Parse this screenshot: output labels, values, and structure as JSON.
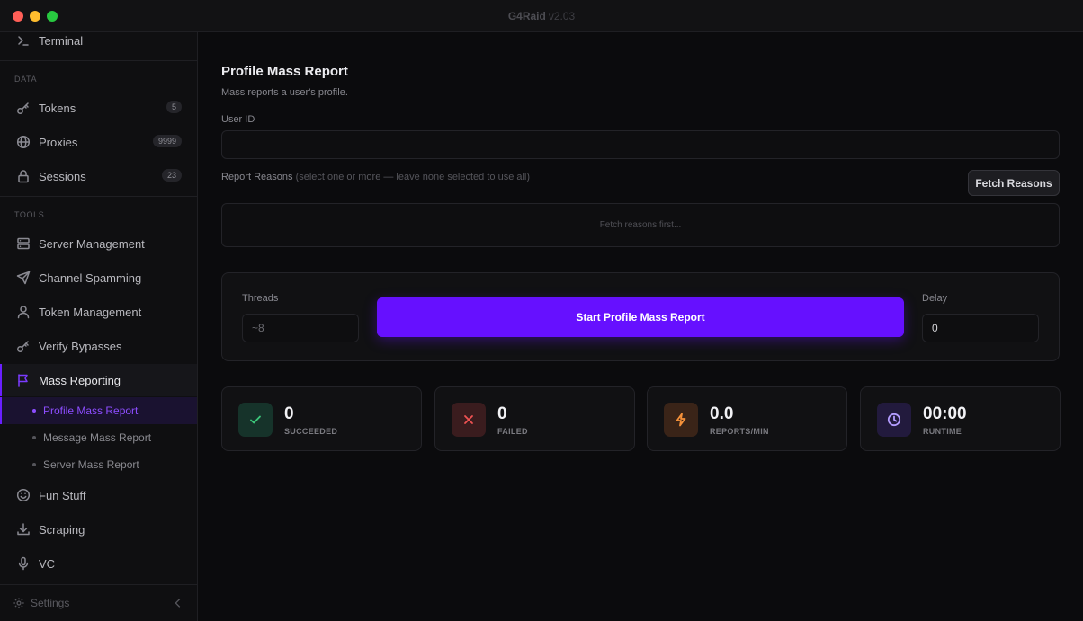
{
  "window": {
    "title": "G4Raid",
    "version": "v2.03"
  },
  "colors": {
    "accent": "#6610ff",
    "success": "#3cc77a",
    "danger": "#f05252",
    "warning": "#f5913a",
    "runtime": "#b39cff"
  },
  "sidebar": {
    "terminal": {
      "label": "Terminal",
      "icon": "terminal-icon"
    },
    "data_section": "DATA",
    "data_items": [
      {
        "label": "Tokens",
        "icon": "key-icon",
        "badge": "5"
      },
      {
        "label": "Proxies",
        "icon": "globe-icon",
        "badge": "9999"
      },
      {
        "label": "Sessions",
        "icon": "lock-icon",
        "badge": "23"
      }
    ],
    "tools_section": "TOOLS",
    "tools_items": [
      {
        "label": "Server Management",
        "icon": "server-icon"
      },
      {
        "label": "Channel Spamming",
        "icon": "send-icon"
      },
      {
        "label": "Token Management",
        "icon": "user-icon"
      },
      {
        "label": "Verify Bypasses",
        "icon": "key-icon"
      },
      {
        "label": "Mass Reporting",
        "icon": "flag-icon"
      }
    ],
    "mass_reporting_sub": [
      {
        "label": "Profile Mass Report"
      },
      {
        "label": "Message Mass Report"
      },
      {
        "label": "Server Mass Report"
      }
    ],
    "more_items": [
      {
        "label": "Fun Stuff",
        "icon": "smile-icon"
      },
      {
        "label": "Scraping",
        "icon": "download-icon"
      },
      {
        "label": "VC",
        "icon": "mic-icon"
      }
    ],
    "settings_label": "Settings"
  },
  "main": {
    "title": "Profile Mass Report",
    "description": "Mass reports a user's profile.",
    "user_id_label": "User ID",
    "user_id_value": "",
    "reasons_label": "Report Reasons",
    "reasons_hint": "(select one or more — leave none selected to use all)",
    "fetch_button": "Fetch Reasons",
    "reasons_placeholder": "Fetch reasons first...",
    "threads_label": "Threads",
    "threads_placeholder": "~8",
    "start_button": "Start Profile Mass Report",
    "delay_label": "Delay",
    "delay_value": "0"
  },
  "stats": [
    {
      "value": "0",
      "label": "SUCCEEDED",
      "icon": "check-icon"
    },
    {
      "value": "0",
      "label": "FAILED",
      "icon": "x-icon"
    },
    {
      "value": "0.0",
      "label": "REPORTS/MIN",
      "icon": "bolt-icon"
    },
    {
      "value": "00:00",
      "label": "RUNTIME",
      "icon": "clock-icon"
    }
  ]
}
